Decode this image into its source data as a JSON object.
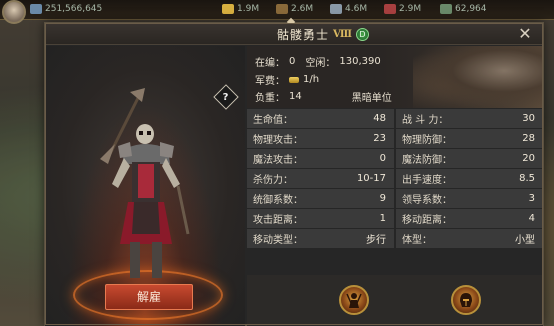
{
  "topbar": {
    "resources": [
      {
        "icon": "gem-icon",
        "value": "251,566,645",
        "color": "#6a8aa8"
      },
      {
        "icon": "gold-icon",
        "value": "1.9M",
        "color": "#d8b040"
      },
      {
        "icon": "wood-icon",
        "value": "2.6M",
        "color": "#8a6a3a"
      },
      {
        "icon": "stone-icon",
        "value": "4.6M",
        "color": "#8a9aa8"
      },
      {
        "icon": "iron-icon",
        "value": "2.9M",
        "color": "#a84040"
      },
      {
        "icon": "food-icon",
        "value": "62,964",
        "color": "#6a8a6a"
      }
    ]
  },
  "dialog": {
    "title": "骷髅勇士",
    "rank": "Ⅷ",
    "badge": "D",
    "close_icon": "close-icon",
    "dismiss_label": "解雇",
    "help_label": "?",
    "info": {
      "line1_a_label": "在编：",
      "line1_a_value": "0",
      "line1_b_label": "空闲：",
      "line1_b_value": "130,390",
      "upkeep_label": "军费：",
      "upkeep_value": "1/h",
      "load_label": "负重：",
      "load_value": "14",
      "unit_type": "黑暗单位"
    },
    "stats": [
      [
        {
          "label": "生命值：",
          "value": "48"
        },
        {
          "label": "战 斗 力：",
          "value": "30"
        }
      ],
      [
        {
          "label": "物理攻击：",
          "value": "23"
        },
        {
          "label": "物理防御：",
          "value": "28"
        }
      ],
      [
        {
          "label": "魔法攻击：",
          "value": "0"
        },
        {
          "label": "魔法防御：",
          "value": "20"
        }
      ],
      [
        {
          "label": "杀伤力：",
          "value": "10-17"
        },
        {
          "label": "出手速度：",
          "value": "8.5"
        }
      ],
      [
        {
          "label": "统御系数：",
          "value": "9"
        },
        {
          "label": "领导系数：",
          "value": "3"
        }
      ],
      [
        {
          "label": "攻击距离：",
          "value": "1"
        },
        {
          "label": "移动距离：",
          "value": "4"
        }
      ],
      [
        {
          "label": "移动类型：",
          "value": "步行"
        },
        {
          "label": "体型：",
          "value": "小型"
        }
      ]
    ],
    "skills": [
      {
        "icon": "warrior-skill-icon"
      },
      {
        "icon": "helmet-skill-icon"
      }
    ]
  }
}
